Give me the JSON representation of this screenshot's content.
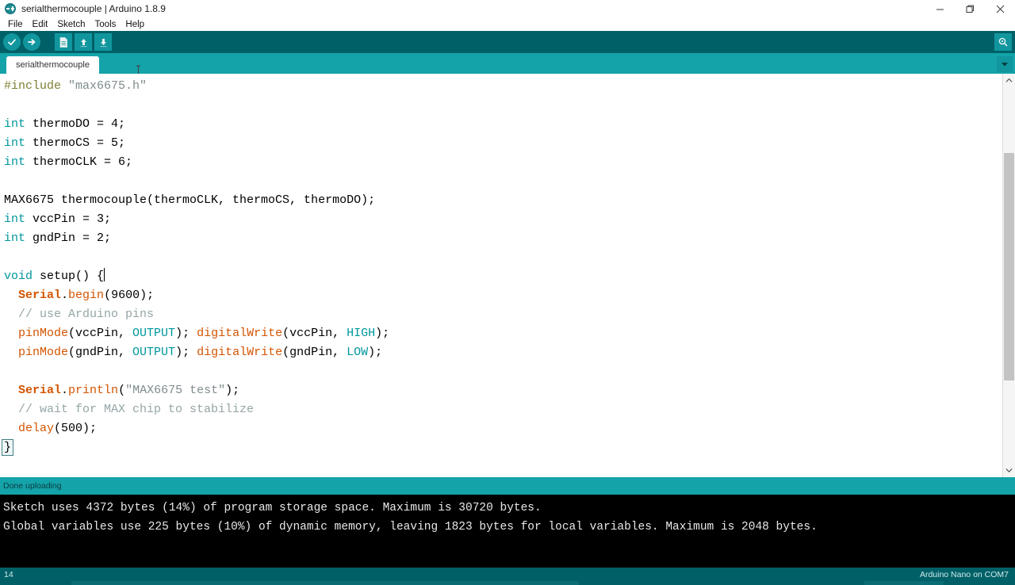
{
  "window": {
    "title": "serialthermocouple | Arduino 1.8.9",
    "logo_name": "arduino-logo",
    "minimize_label": "−",
    "maximize_label": "❐",
    "close_label": "✕"
  },
  "menubar": {
    "items": [
      {
        "label": "File"
      },
      {
        "label": "Edit"
      },
      {
        "label": "Sketch"
      },
      {
        "label": "Tools"
      },
      {
        "label": "Help"
      }
    ]
  },
  "toolbar": {
    "verify_label": "Verify",
    "upload_label": "Upload",
    "new_label": "New",
    "open_label": "Open",
    "save_label": "Save",
    "serial_monitor_label": "Serial Monitor"
  },
  "tabs": {
    "items": [
      {
        "label": "serialthermocouple",
        "active": true
      }
    ],
    "menu_label": "Tab menu"
  },
  "editor": {
    "lines": [
      [
        {
          "t": "#include ",
          "c": "t-pre"
        },
        {
          "t": "\"max6675.h\"",
          "c": "t-str"
        }
      ],
      [],
      [
        {
          "t": "int",
          "c": "t-kw"
        },
        {
          "t": " thermoDO = 4;",
          "c": "t-txt"
        }
      ],
      [
        {
          "t": "int",
          "c": "t-kw"
        },
        {
          "t": " thermoCS = 5;",
          "c": "t-txt"
        }
      ],
      [
        {
          "t": "int",
          "c": "t-kw"
        },
        {
          "t": " thermoCLK = 6;",
          "c": "t-txt"
        }
      ],
      [],
      [
        {
          "t": "MAX6675 thermocouple(thermoCLK, thermoCS, thermoDO);",
          "c": "t-txt"
        }
      ],
      [
        {
          "t": "int",
          "c": "t-kw"
        },
        {
          "t": " vccPin = 3;",
          "c": "t-txt"
        }
      ],
      [
        {
          "t": "int",
          "c": "t-kw"
        },
        {
          "t": " gndPin = 2;",
          "c": "t-txt"
        }
      ],
      [],
      [
        {
          "t": "void",
          "c": "t-kw"
        },
        {
          "t": " setup() {",
          "c": "t-txt"
        },
        {
          "t": "",
          "c": "caret"
        }
      ],
      [
        {
          "t": "  ",
          "c": "t-txt"
        },
        {
          "t": "Serial",
          "c": "t-fnb"
        },
        {
          "t": ".",
          "c": "t-txt"
        },
        {
          "t": "begin",
          "c": "t-fn"
        },
        {
          "t": "(9600);",
          "c": "t-txt"
        }
      ],
      [
        {
          "t": "  // use Arduino pins",
          "c": "t-cmt"
        }
      ],
      [
        {
          "t": "  ",
          "c": "t-txt"
        },
        {
          "t": "pinMode",
          "c": "t-fn"
        },
        {
          "t": "(vccPin, ",
          "c": "t-txt"
        },
        {
          "t": "OUTPUT",
          "c": "t-lit"
        },
        {
          "t": "); ",
          "c": "t-txt"
        },
        {
          "t": "digitalWrite",
          "c": "t-fn"
        },
        {
          "t": "(vccPin, ",
          "c": "t-txt"
        },
        {
          "t": "HIGH",
          "c": "t-lit"
        },
        {
          "t": ");",
          "c": "t-txt"
        }
      ],
      [
        {
          "t": "  ",
          "c": "t-txt"
        },
        {
          "t": "pinMode",
          "c": "t-fn"
        },
        {
          "t": "(gndPin, ",
          "c": "t-txt"
        },
        {
          "t": "OUTPUT",
          "c": "t-lit"
        },
        {
          "t": "); ",
          "c": "t-txt"
        },
        {
          "t": "digitalWrite",
          "c": "t-fn"
        },
        {
          "t": "(gndPin, ",
          "c": "t-txt"
        },
        {
          "t": "LOW",
          "c": "t-lit"
        },
        {
          "t": ");",
          "c": "t-txt"
        }
      ],
      [],
      [
        {
          "t": "  ",
          "c": "t-txt"
        },
        {
          "t": "Serial",
          "c": "t-fnb"
        },
        {
          "t": ".",
          "c": "t-txt"
        },
        {
          "t": "println",
          "c": "t-fn"
        },
        {
          "t": "(",
          "c": "t-txt"
        },
        {
          "t": "\"MAX6675 test\"",
          "c": "t-str"
        },
        {
          "t": ");",
          "c": "t-txt"
        }
      ],
      [
        {
          "t": "  // wait for MAX chip to stabilize",
          "c": "t-cmt"
        }
      ],
      [
        {
          "t": "  ",
          "c": "t-txt"
        },
        {
          "t": "delay",
          "c": "t-fn"
        },
        {
          "t": "(500);",
          "c": "t-txt"
        }
      ],
      [
        {
          "t": "}",
          "c": "brace-box"
        }
      ]
    ]
  },
  "scrollbar": {
    "up_label": "Scroll up",
    "down_label": "Scroll down",
    "thumb_label": "Scroll thumb"
  },
  "status": {
    "message": "Done uploading"
  },
  "console": {
    "lines": [
      "Sketch uses 4372 bytes (14%) of program storage space. Maximum is 30720 bytes.",
      "Global variables use 225 bytes (10%) of dynamic memory, leaving 1823 bytes for local variables. Maximum is 2048 bytes."
    ]
  },
  "bottombar": {
    "line_number": "14",
    "board": "Arduino Nano on COM7"
  },
  "colors": {
    "toolbar_dark_teal": "#006068",
    "tabbar_teal": "#13a3a9",
    "button_teal": "#11969e",
    "console_bg": "#000000",
    "keyword": "#00979c",
    "function": "#d35400",
    "comment": "#95a5a6",
    "string": "#7f8c8d",
    "preprocessor": "#7f7e33"
  }
}
